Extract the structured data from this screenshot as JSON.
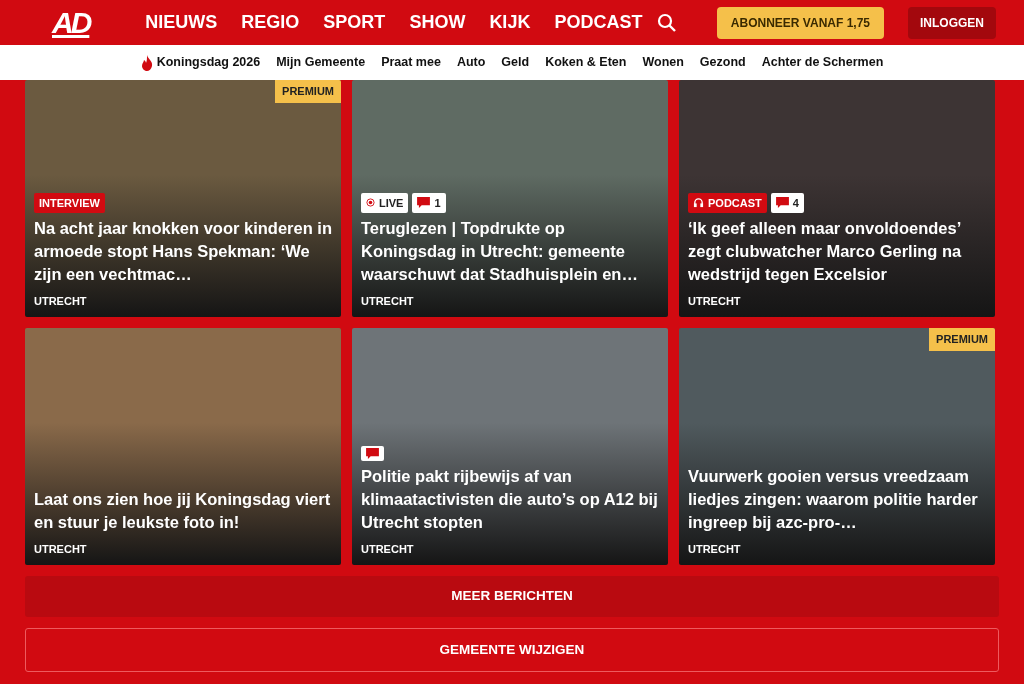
{
  "header": {
    "logo": "AD",
    "nav": [
      {
        "label": "NIEUWS"
      },
      {
        "label": "REGIO"
      },
      {
        "label": "SPORT"
      },
      {
        "label": "SHOW"
      },
      {
        "label": "KIJK"
      },
      {
        "label": "PODCAST"
      }
    ],
    "subscribe": "ABONNEER VANAF 1,75",
    "login": "INLOGGEN"
  },
  "subnav": [
    {
      "label": "Koningsdag 2026",
      "kind": "hot"
    },
    {
      "label": "Mijn Gemeente",
      "kind": "plain"
    },
    {
      "label": "Praat mee",
      "kind": "plain"
    },
    {
      "label": "Auto",
      "kind": "plain"
    },
    {
      "label": "Geld",
      "kind": "plain"
    },
    {
      "label": "Koken & Eten",
      "kind": "plain"
    },
    {
      "label": "Wonen",
      "kind": "plain"
    },
    {
      "label": "Gezond",
      "kind": "plain"
    },
    {
      "label": "Achter de Schermen",
      "kind": "plain"
    }
  ],
  "cards": [
    {
      "premium": true,
      "premium_label": "PREMIUM",
      "tag": {
        "kind": "interview",
        "label": "INTERVIEW"
      },
      "title": "Na acht jaar knokken voor kinderen in armoede stopt Hans Spekman: ‘We zijn een vechtmac…",
      "location": "UTRECHT"
    },
    {
      "premium": false,
      "tag": {
        "kind": "live",
        "label": "LIVE"
      },
      "comments": true,
      "comment_count": "1",
      "title": "Teruglezen | Topdrukte op Koningsdag in Utrecht: gemeente waarschuwt dat Stadhuisplein en…",
      "location": "UTRECHT"
    },
    {
      "premium": false,
      "tag": {
        "kind": "podcast",
        "label": "PODCAST"
      },
      "comments": true,
      "comment_count": "4",
      "title": "‘Ik geef alleen maar onvoldoendes’ zegt clubwatcher Marco Gerling na wedstrijd tegen Excelsior",
      "location": "UTRECHT"
    },
    {
      "premium": false,
      "title": "Laat ons zien hoe jij Koningsdag viert en stuur je leukste foto in!",
      "location": "UTRECHT"
    },
    {
      "premium": false,
      "comments": true,
      "title": "Politie pakt rijbewijs af van klimaatactivisten die auto’s op A12 bij Utrecht stopten",
      "location": "UTRECHT"
    },
    {
      "premium": true,
      "premium_label": "PREMIUM",
      "title": "Vuurwerk gooien versus vreedzaam liedjes zingen: waarom politie harder ingreep bij azc-pro-…",
      "location": "UTRECHT"
    }
  ],
  "more_button": "MEER BERICHTEN",
  "change_button": "GEMEENTE WIJZIGEN"
}
